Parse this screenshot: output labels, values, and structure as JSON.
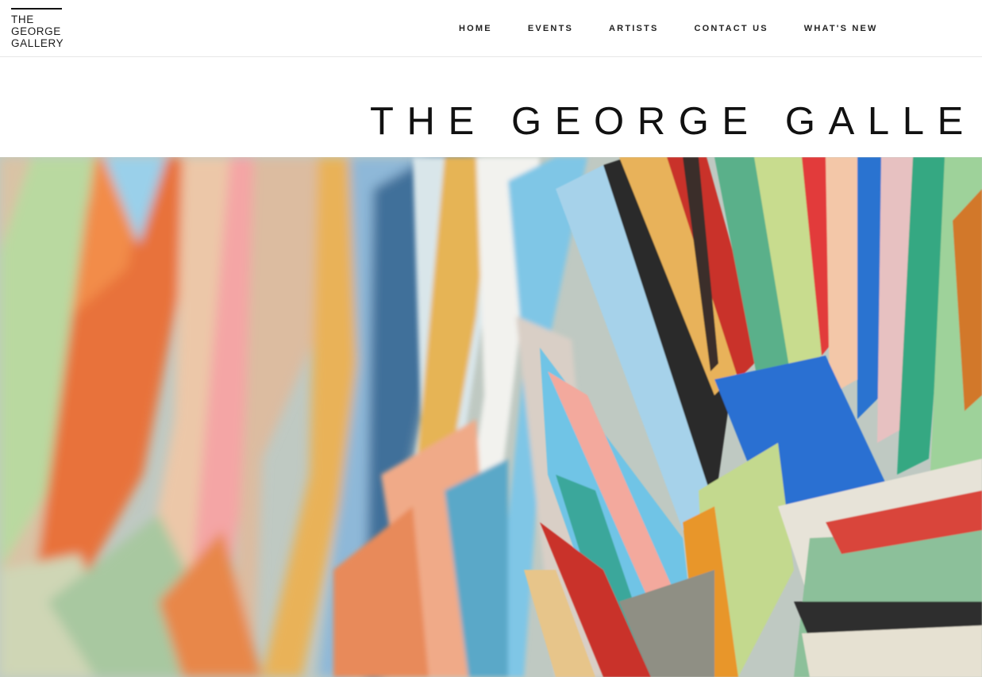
{
  "brand": {
    "logo_lines": [
      "THE",
      "GEORGE",
      "GALLERY"
    ]
  },
  "nav": {
    "items": [
      {
        "label": "HOME"
      },
      {
        "label": "EVENTS"
      },
      {
        "label": "ARTISTS"
      },
      {
        "label": "CONTACT US"
      },
      {
        "label": "WHAT'S NEW"
      }
    ]
  },
  "banner": {
    "title": "THE GEORGE GALLERY"
  },
  "hero": {
    "image_subject": "abstract-painting-closeup",
    "colors": [
      "#e8723a",
      "#8ec8e8",
      "#e7c8a8",
      "#58a88a",
      "#2b7bd0",
      "#c9332b",
      "#e8b45a",
      "#b8d88a",
      "#f2a7b0",
      "#3a3a3a"
    ]
  }
}
